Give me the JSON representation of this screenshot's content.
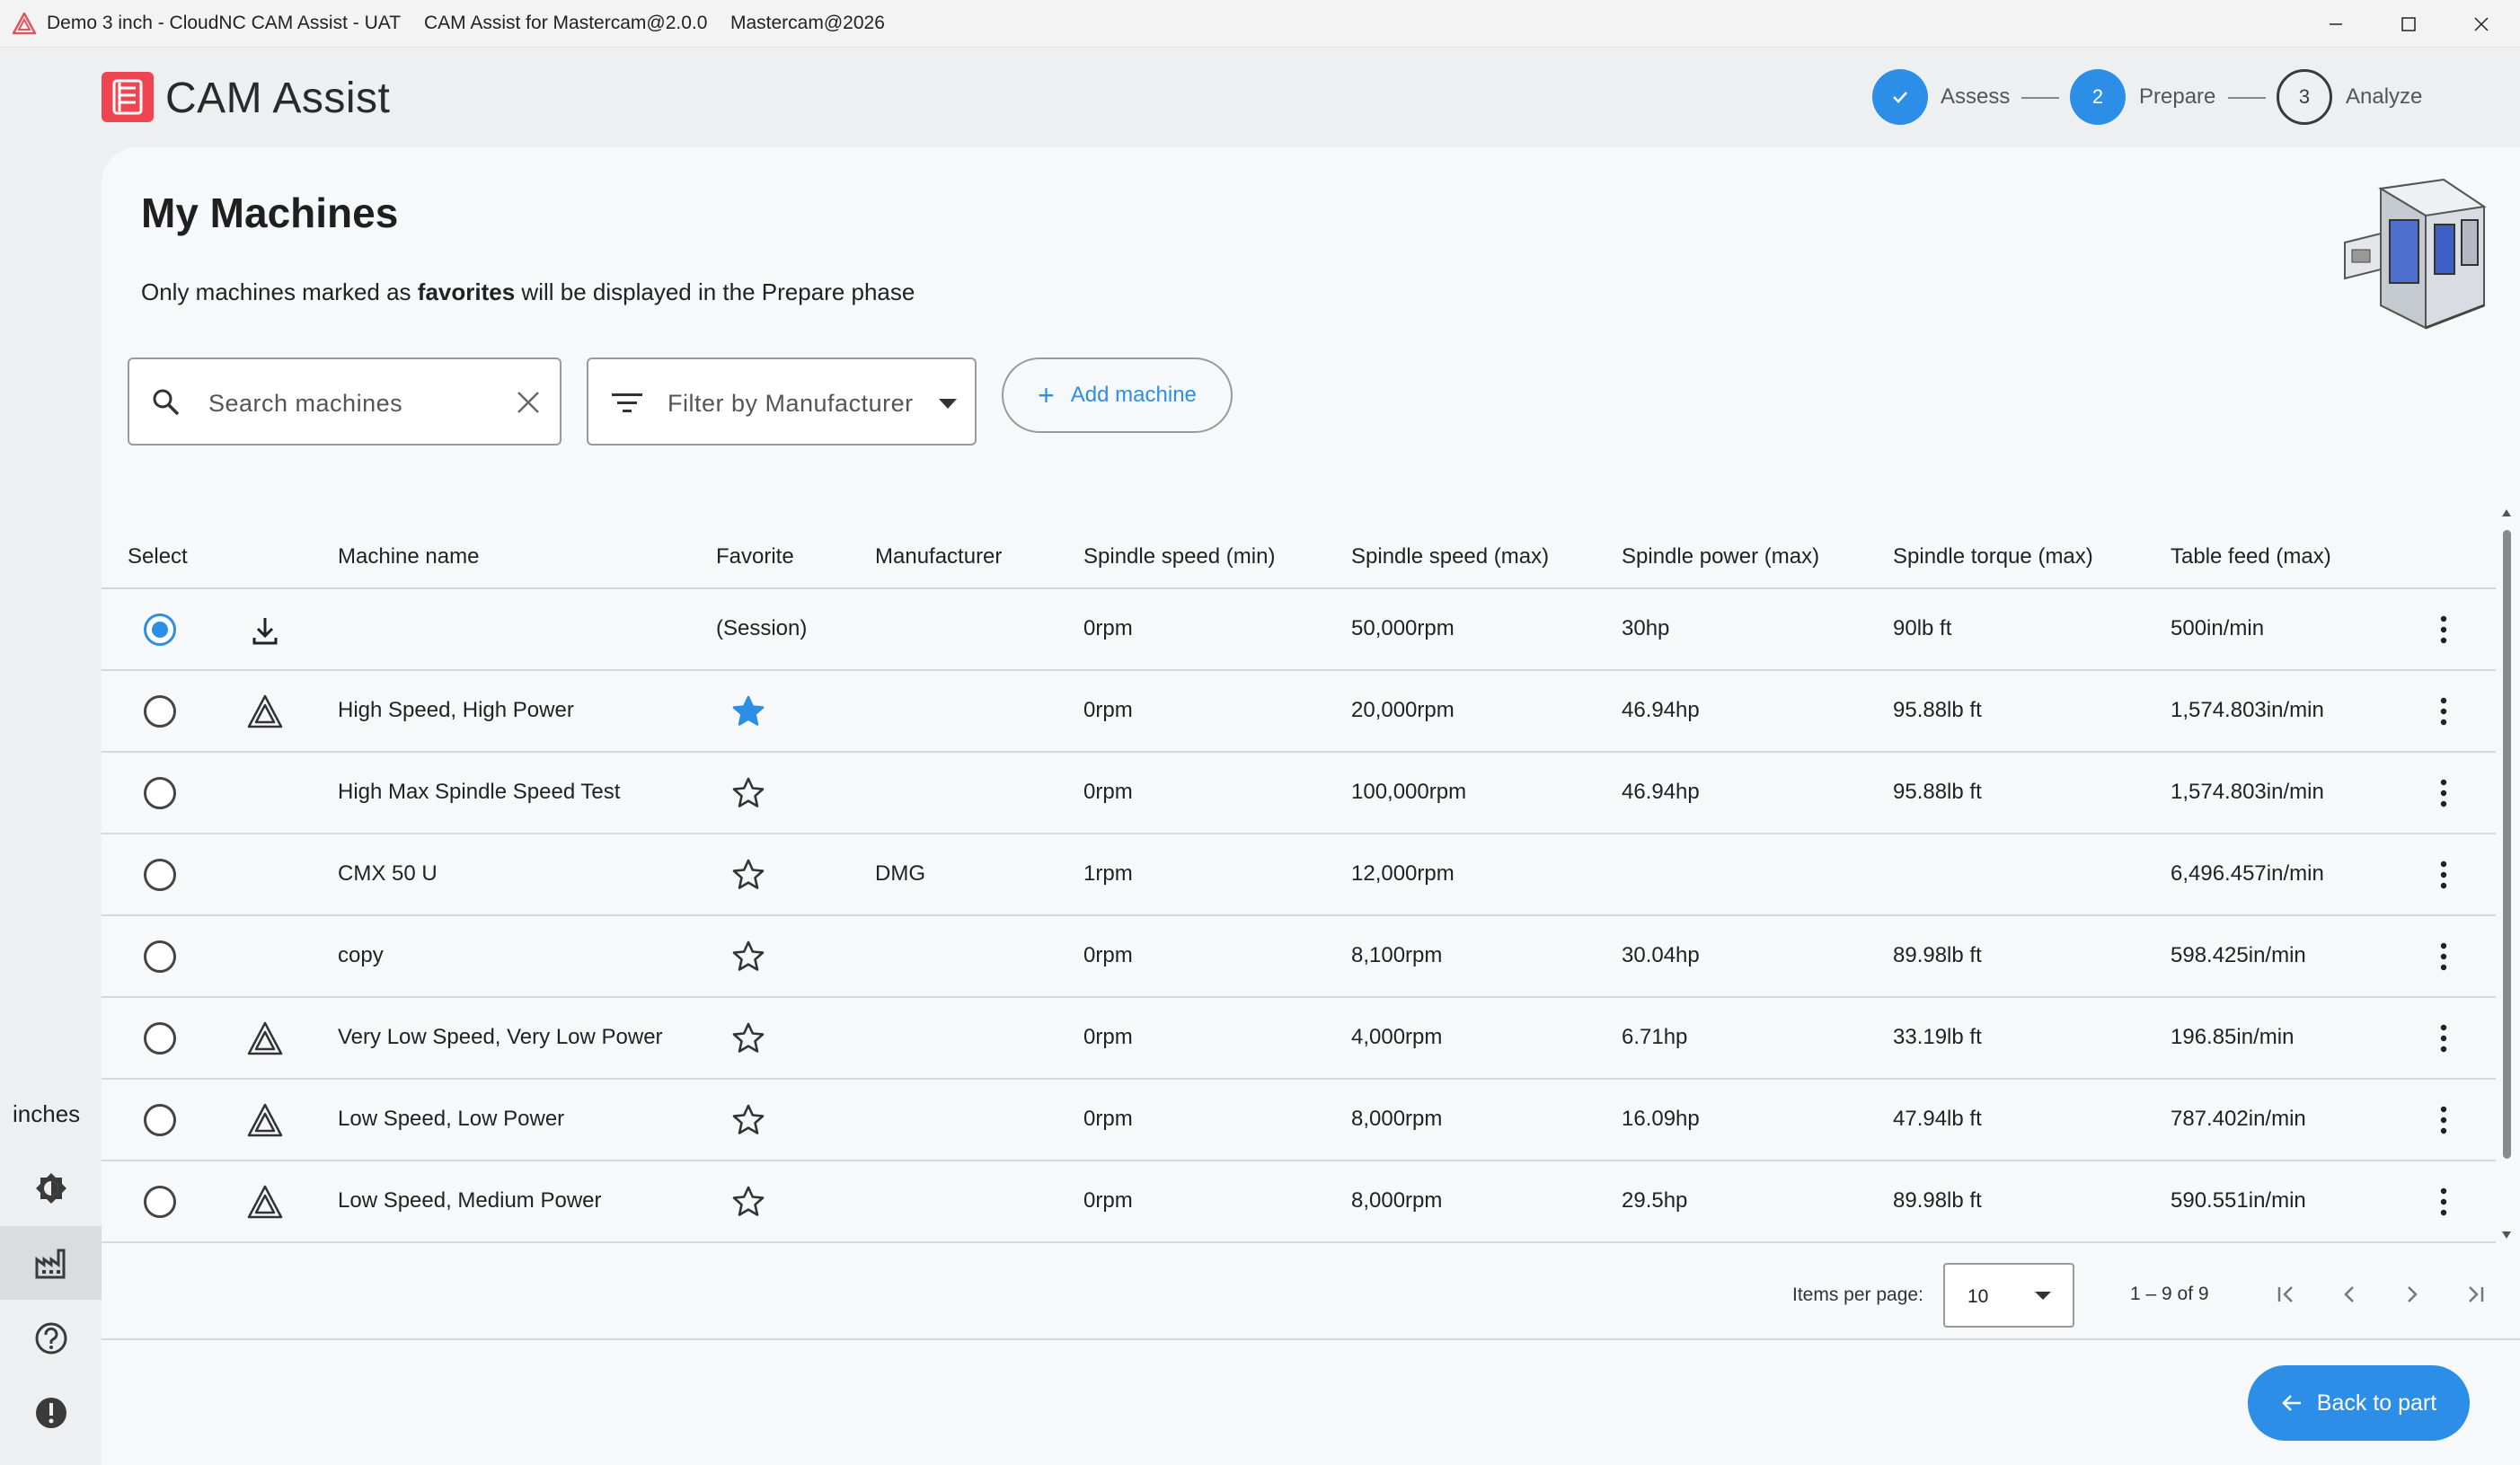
{
  "window": {
    "title_parts": [
      "Demo 3 inch - CloudNC CAM Assist - UAT",
      "CAM Assist for Mastercam@2.0.0",
      "Mastercam@2026"
    ],
    "controls": [
      "minimize",
      "maximize",
      "close"
    ]
  },
  "brand": {
    "name": "CAM Assist",
    "color": "#ef4451"
  },
  "stepper": [
    {
      "label": "Assess",
      "state": "done",
      "number": ""
    },
    {
      "label": "Prepare",
      "state": "active",
      "number": "2"
    },
    {
      "label": "Analyze",
      "state": "todo",
      "number": "3"
    }
  ],
  "sidebar": {
    "units": "inches",
    "items": [
      {
        "icon": "theme-toggle-icon",
        "selected": false
      },
      {
        "icon": "factory-icon",
        "selected": true
      },
      {
        "icon": "help-icon",
        "selected": false
      },
      {
        "icon": "alert-icon",
        "selected": false
      }
    ]
  },
  "page": {
    "title": "My Machines",
    "subtitle_pre": "Only machines marked as ",
    "subtitle_bold": "favorites",
    "subtitle_post": " will be displayed in the Prepare phase"
  },
  "toolbar": {
    "search_placeholder": "Search machines",
    "filter_label": "Filter by Manufacturer",
    "add_label": "Add machine"
  },
  "table": {
    "columns": [
      "Select",
      "Machine name",
      "Favorite",
      "Manufacturer",
      "Spindle speed (min)",
      "Spindle speed (max)",
      "Spindle power (max)",
      "Spindle torque (max)",
      "Table feed (max)"
    ],
    "rows": [
      {
        "selected": true,
        "icon": "download",
        "name": "",
        "favorite": "(Session)",
        "manufacturer": "",
        "speed_min": "0rpm",
        "speed_max": "50,000rpm",
        "power": "30hp",
        "torque": "90lb ft",
        "feed": "500in/min"
      },
      {
        "selected": false,
        "icon": "cloudnc",
        "name": "High Speed, High Power",
        "favorite": "filled",
        "manufacturer": "",
        "speed_min": "0rpm",
        "speed_max": "20,000rpm",
        "power": "46.94hp",
        "torque": "95.88lb ft",
        "feed": "1,574.803in/min"
      },
      {
        "selected": false,
        "icon": "",
        "name": "High Max Spindle Speed Test",
        "favorite": "empty",
        "manufacturer": "",
        "speed_min": "0rpm",
        "speed_max": "100,000rpm",
        "power": "46.94hp",
        "torque": "95.88lb ft",
        "feed": "1,574.803in/min"
      },
      {
        "selected": false,
        "icon": "",
        "name": "CMX 50 U",
        "favorite": "empty",
        "manufacturer": "DMG",
        "speed_min": "1rpm",
        "speed_max": "12,000rpm",
        "power": "",
        "torque": "",
        "feed": "6,496.457in/min"
      },
      {
        "selected": false,
        "icon": "",
        "name": "copy",
        "favorite": "empty",
        "manufacturer": "",
        "speed_min": "0rpm",
        "speed_max": "8,100rpm",
        "power": "30.04hp",
        "torque": "89.98lb ft",
        "feed": "598.425in/min"
      },
      {
        "selected": false,
        "icon": "cloudnc",
        "name": "Very Low Speed, Very Low Power",
        "favorite": "empty",
        "manufacturer": "",
        "speed_min": "0rpm",
        "speed_max": "4,000rpm",
        "power": "6.71hp",
        "torque": "33.19lb ft",
        "feed": "196.85in/min"
      },
      {
        "selected": false,
        "icon": "cloudnc",
        "name": "Low Speed, Low Power",
        "favorite": "empty",
        "manufacturer": "",
        "speed_min": "0rpm",
        "speed_max": "8,000rpm",
        "power": "16.09hp",
        "torque": "47.94lb ft",
        "feed": "787.402in/min"
      },
      {
        "selected": false,
        "icon": "cloudnc",
        "name": "Low Speed, Medium Power",
        "favorite": "empty",
        "manufacturer": "",
        "speed_min": "0rpm",
        "speed_max": "8,000rpm",
        "power": "29.5hp",
        "torque": "89.98lb ft",
        "feed": "590.551in/min"
      }
    ]
  },
  "pager": {
    "items_per_page_label": "Items per page:",
    "items_per_page": "10",
    "range": "1 – 9 of 9"
  },
  "footer": {
    "back_label": "Back to part"
  },
  "colors": {
    "accent": "#2d8ee8",
    "brand_red": "#ef4451"
  }
}
